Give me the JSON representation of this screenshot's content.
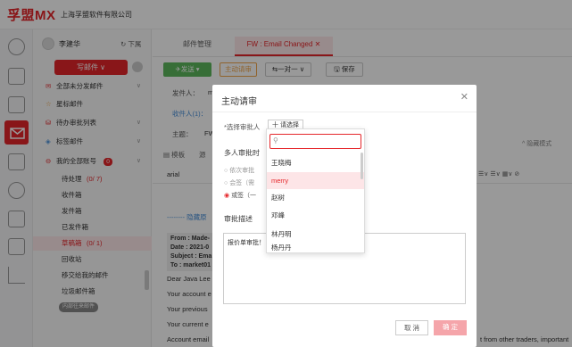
{
  "brand": {
    "logo": "孚盟MX",
    "company": "上海孚盟软件有限公司"
  },
  "user": {
    "name": "李建华",
    "download": "下属"
  },
  "compose_button": "写邮件",
  "folders": {
    "unsent": "全部未分发邮件",
    "starred": "星标邮件",
    "pending": "待办审批列表",
    "labels": "标签邮件",
    "my_accounts": "我的全部账号",
    "my_accounts_badge": "0",
    "todo": "待处理",
    "todo_count": "(0/ 7)",
    "inbox": "收件箱",
    "sent": "发件箱",
    "sent_done": "已发件箱",
    "drafts": "草稿箱",
    "drafts_count": "(0/ 1)",
    "recycle": "回收站",
    "transferred": "移交给我的邮件",
    "spam": "垃圾邮件箱",
    "internal": "内部往来邮件"
  },
  "tabs": {
    "mail_manage": "邮件管理",
    "current": "FW : Email Changed"
  },
  "toolbar": {
    "send": "发送",
    "approve": "主动请审",
    "reply": "一对一",
    "save": "保存",
    "template": "模板",
    "plain": "源"
  },
  "compose": {
    "from_label": "发件人：",
    "from_value": "m",
    "to_label": "收件人(1)：",
    "to_value": "ı",
    "subject_label": "主题：",
    "subject_value": "FW",
    "font": "arial",
    "mode_link": "^ 隐藏模式",
    "hidden_link": "-------- 隐藏原",
    "quote_from": "From : Made-",
    "quote_date": "Date : 2021-0",
    "quote_subject": "Subject : Ema",
    "quote_to": "To : market01",
    "body_1": "Dear Java Lee",
    "body_2": "Your account e",
    "body_3": "Your previous",
    "body_4": "Your current e",
    "body_5": "Account email",
    "body_5_tail": "t from other traders, important"
  },
  "dialog": {
    "title": "主动请审",
    "approver_label": "*选择审批人",
    "select_button": "十 请选择",
    "multi_label": "多人审批时",
    "opt_sequential": "依次审批",
    "opt_joint": "会签（需",
    "opt_or": "或签（一",
    "desc_label": "审批描述",
    "desc_value": "报价单审批！",
    "cancel": "取 消",
    "confirm": "确 定"
  },
  "dropdown": {
    "search_placeholder": "",
    "items": [
      "王晓梅",
      "merry",
      "赵树",
      "邓峰",
      "林丹明",
      "杨丹丹"
    ]
  },
  "colors": {
    "brand": "#e5262a",
    "green": "#5cb85c",
    "orange": "#f0a64a"
  }
}
